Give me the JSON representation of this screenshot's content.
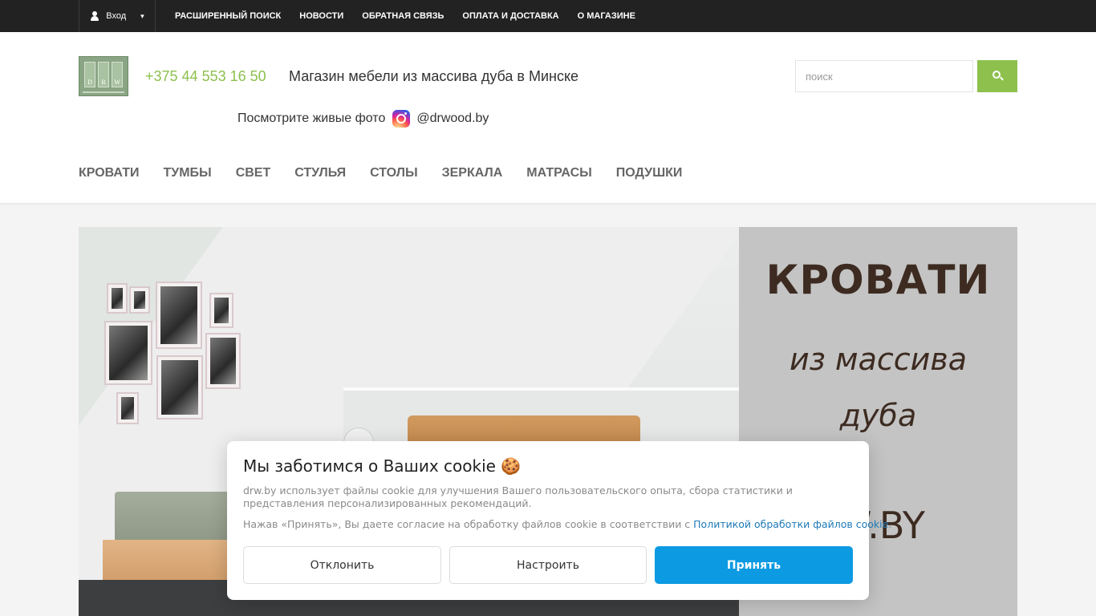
{
  "topbar": {
    "login_label": "Вход",
    "nav": [
      "РАСШИРЕННЫЙ ПОИСК",
      "НОВОСТИ",
      "ОБРАТНАЯ СВЯЗЬ",
      "ОПЛАТА И ДОСТАВКА",
      "О МАГАЗИНЕ"
    ]
  },
  "header": {
    "logo_letters": [
      "D",
      "R",
      "W"
    ],
    "phone": "+375 44 553 16 50",
    "tagline": "Магазин мебели из массива дуба в Минске",
    "insta_prompt": "Посмотрите живые фото",
    "insta_handle": "@drwood.by",
    "search_placeholder": "поиск",
    "icons": {
      "user": "user-icon",
      "search": "search-icon",
      "instagram": "instagram-icon",
      "dropdown": "chevron-down-icon"
    }
  },
  "categories": [
    "КРОВАТИ",
    "ТУМБЫ",
    "СВЕТ",
    "СТУЛЬЯ",
    "СТОЛЫ",
    "ЗЕРКАЛА",
    "МАТРАСЫ",
    "ПОДУШКИ"
  ],
  "banner": {
    "title": "КРОВАТИ",
    "subtitle_line1": "из массива",
    "subtitle_line2": "дуба",
    "site_fragment": "W.BY"
  },
  "cookie": {
    "title": "Мы заботимся о Ваших cookie 🍪",
    "text": "drw.by использует файлы cookie для улучшения Вашего пользовательского опыта, сбора статистики и представления персонализированных рекомендаций.",
    "consent_prefix": "Нажав «Принять», Вы даете согласие на обработку файлов cookie в соответствии с",
    "policy_link": "Политикой обработки файлов cookie",
    "consent_suffix": ".",
    "decline_label": "Отклонить",
    "configure_label": "Настроить",
    "accept_label": "Принять"
  },
  "colors": {
    "topbar_bg": "#222222",
    "accent_green": "#8dc04d",
    "accept_blue": "#0c9ae3",
    "link_blue": "#1e7ab8",
    "banner_text": "#3d2b21"
  }
}
